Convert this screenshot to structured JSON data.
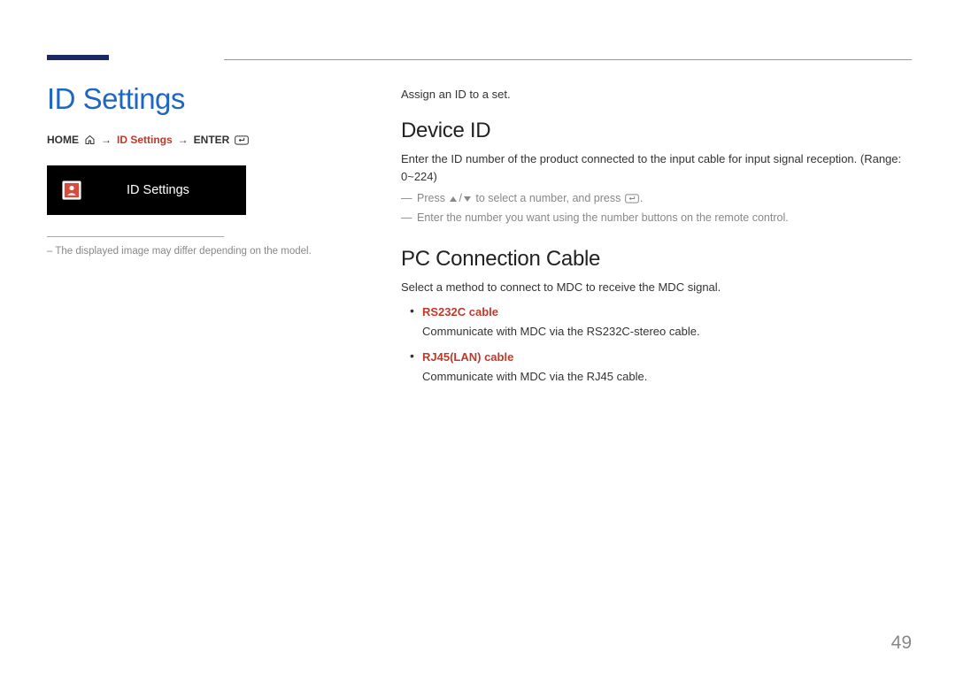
{
  "left": {
    "title": "ID Settings",
    "breadcrumb": {
      "home": "HOME",
      "mid": "ID Settings",
      "enter": "ENTER"
    },
    "menu_label": "ID Settings",
    "footnote": "The displayed image may differ depending on the model."
  },
  "right": {
    "intro": "Assign an ID to a set.",
    "device_id": {
      "title": "Device ID",
      "desc": "Enter the ID number of the product connected to the input cable for input signal reception. (Range: 0~224)",
      "note1_a": "Press ",
      "note1_b": " to select a number, and press ",
      "note1_c": ".",
      "note2": "Enter the number you want using the number buttons on the remote control."
    },
    "pc_cable": {
      "title": "PC Connection Cable",
      "desc": "Select a method to connect to MDC to receive the MDC signal.",
      "items": [
        {
          "label": "RS232C cable",
          "desc": "Communicate with MDC via the RS232C-stereo cable."
        },
        {
          "label": "RJ45(LAN) cable",
          "desc": "Communicate with MDC via the RJ45 cable."
        }
      ]
    }
  },
  "page_number": "49"
}
